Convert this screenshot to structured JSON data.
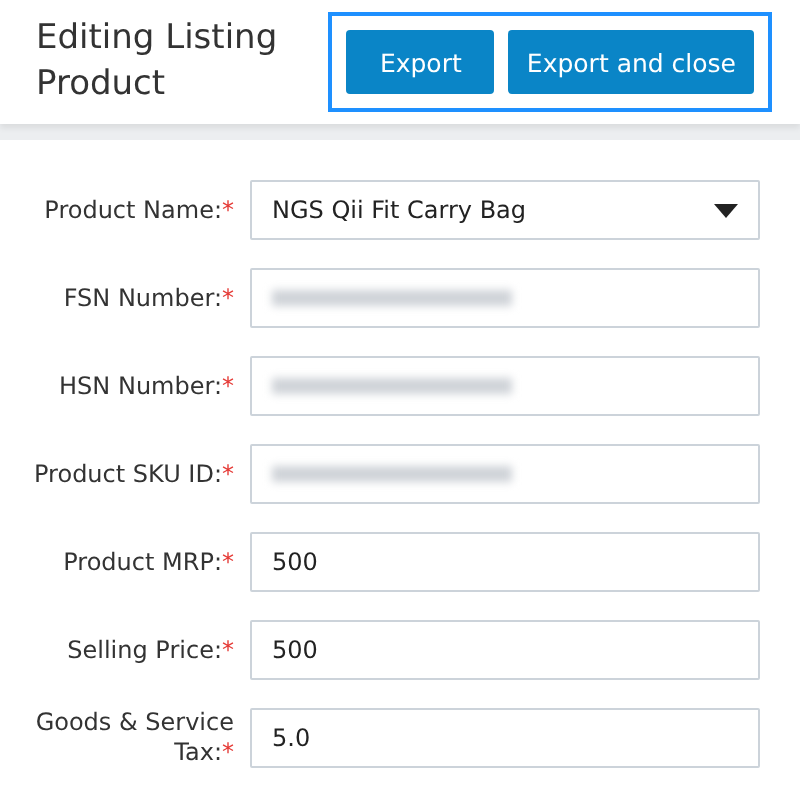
{
  "header": {
    "title": "Editing Listing Product",
    "buttons": [
      "Export",
      "Export and close"
    ]
  },
  "fields": [
    {
      "label": "Product Name:",
      "required_mark": "*",
      "kind": "select",
      "value": "NGS Qii Fit Carry Bag"
    },
    {
      "label": "FSN Number:",
      "required_mark": "*",
      "kind": "redacted"
    },
    {
      "label": "HSN Number:",
      "required_mark": "*",
      "kind": "redacted"
    },
    {
      "label": "Product SKU ID:",
      "required_mark": "*",
      "kind": "redacted"
    },
    {
      "label": "Product MRP:",
      "required_mark": "*",
      "kind": "text",
      "value": "500"
    },
    {
      "label": "Selling Price:",
      "required_mark": "*",
      "kind": "text",
      "value": "500"
    },
    {
      "label": "Goods & Service Tax:",
      "required_mark": "*",
      "kind": "text",
      "value": "5.0"
    }
  ]
}
